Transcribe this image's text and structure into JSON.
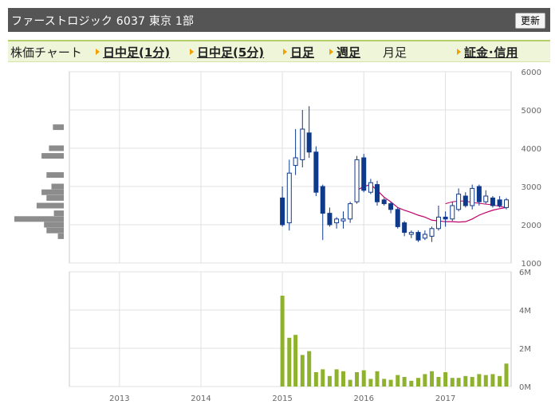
{
  "header": {
    "title": "ファーストロジック 6037 東京 1部",
    "refresh_label": "更新"
  },
  "tabs": [
    {
      "label": "株価チャート",
      "link": false
    },
    {
      "label": "日中足(1分)",
      "link": true
    },
    {
      "label": "日中足(5分)",
      "link": true
    },
    {
      "label": "日足",
      "link": true
    },
    {
      "label": "週足",
      "link": true
    },
    {
      "label": "月足",
      "link": false
    },
    {
      "label": "証金･信用",
      "link": true
    }
  ],
  "colors": {
    "up_candle": "#ffffff",
    "down_candle": "#0f3a8c",
    "moving_average": "#c0006b",
    "volume": "#8fb22e",
    "volume_profile": "#8c8c8c"
  },
  "chart_data": [
    {
      "type": "candlestick",
      "x_ticks": [
        "2013",
        "2014",
        "2015",
        "2016",
        "2017"
      ],
      "x_range": [
        "2012-06",
        "2017-10"
      ],
      "ylim": [
        1000,
        6000
      ],
      "y_ticks": [
        "6000",
        "5000",
        "4000",
        "3000",
        "2000",
        "1000"
      ],
      "grid": true,
      "candles": [
        {
          "date": "2015-01",
          "open": 2700,
          "high": 3000,
          "low": 1950,
          "close": 2000
        },
        {
          "date": "2015-02",
          "open": 2050,
          "high": 3700,
          "low": 1850,
          "close": 3350
        },
        {
          "date": "2015-03",
          "open": 3550,
          "high": 4500,
          "low": 3300,
          "close": 3750
        },
        {
          "date": "2015-04",
          "open": 3700,
          "high": 5000,
          "low": 3500,
          "close": 4500
        },
        {
          "date": "2015-05",
          "open": 4400,
          "high": 5100,
          "low": 3750,
          "close": 3900
        },
        {
          "date": "2015-06",
          "open": 3900,
          "high": 4050,
          "low": 2750,
          "close": 2850
        },
        {
          "date": "2015-07",
          "open": 3000,
          "high": 3050,
          "low": 1600,
          "close": 2300
        },
        {
          "date": "2015-08",
          "open": 2300,
          "high": 2450,
          "low": 1950,
          "close": 2000
        },
        {
          "date": "2015-09",
          "open": 2050,
          "high": 2200,
          "low": 1900,
          "close": 2150
        },
        {
          "date": "2015-10",
          "open": 2100,
          "high": 2350,
          "low": 1900,
          "close": 2150
        },
        {
          "date": "2015-11",
          "open": 2150,
          "high": 2600,
          "low": 2050,
          "close": 2550
        },
        {
          "date": "2015-12",
          "open": 2600,
          "high": 3800,
          "low": 2550,
          "close": 3700
        },
        {
          "date": "2016-01",
          "open": 3750,
          "high": 3850,
          "low": 2850,
          "close": 2900
        },
        {
          "date": "2016-02",
          "open": 2850,
          "high": 3200,
          "low": 2800,
          "close": 3100
        },
        {
          "date": "2016-03",
          "open": 3050,
          "high": 3150,
          "low": 2500,
          "close": 2600
        },
        {
          "date": "2016-04",
          "open": 2650,
          "high": 2700,
          "low": 2500,
          "close": 2550
        },
        {
          "date": "2016-05",
          "open": 2550,
          "high": 2600,
          "low": 2300,
          "close": 2400
        },
        {
          "date": "2016-06",
          "open": 2400,
          "high": 2450,
          "low": 1900,
          "close": 1950
        },
        {
          "date": "2016-07",
          "open": 2050,
          "high": 2100,
          "low": 1700,
          "close": 1800
        },
        {
          "date": "2016-08",
          "open": 1750,
          "high": 1850,
          "low": 1650,
          "close": 1800
        },
        {
          "date": "2016-09",
          "open": 1800,
          "high": 1850,
          "low": 1550,
          "close": 1600
        },
        {
          "date": "2016-10",
          "open": 1650,
          "high": 1850,
          "low": 1600,
          "close": 1750
        },
        {
          "date": "2016-11",
          "open": 1700,
          "high": 1950,
          "low": 1550,
          "close": 1900
        },
        {
          "date": "2016-12",
          "open": 1900,
          "high": 2500,
          "low": 1850,
          "close": 2200
        },
        {
          "date": "2017-01",
          "open": 2200,
          "high": 2350,
          "low": 1950,
          "close": 2150
        },
        {
          "date": "2017-02",
          "open": 2150,
          "high": 2600,
          "low": 2100,
          "close": 2500
        },
        {
          "date": "2017-03",
          "open": 2400,
          "high": 2950,
          "low": 2350,
          "close": 2800
        },
        {
          "date": "2017-04",
          "open": 2750,
          "high": 2850,
          "low": 2450,
          "close": 2500
        },
        {
          "date": "2017-05",
          "open": 2500,
          "high": 3050,
          "low": 2400,
          "close": 2950
        },
        {
          "date": "2017-06",
          "open": 3000,
          "high": 3050,
          "low": 2500,
          "close": 2600
        },
        {
          "date": "2017-07",
          "open": 2600,
          "high": 2900,
          "low": 2550,
          "close": 2750
        },
        {
          "date": "2017-08",
          "open": 2700,
          "high": 2750,
          "low": 2450,
          "close": 2500
        },
        {
          "date": "2017-09",
          "open": 2650,
          "high": 2750,
          "low": 2450,
          "close": 2500
        },
        {
          "date": "2017-10",
          "open": 2450,
          "high": 2700,
          "low": 2400,
          "close": 2650
        }
      ],
      "moving_average": [
        {
          "date": "2015-12",
          "value": 2900
        },
        {
          "date": "2016-01",
          "value": 3000
        },
        {
          "date": "2016-02",
          "value": 3050
        },
        {
          "date": "2016-03",
          "value": 2900
        },
        {
          "date": "2016-04",
          "value": 2720
        },
        {
          "date": "2016-05",
          "value": 2600
        },
        {
          "date": "2016-06",
          "value": 2450
        },
        {
          "date": "2016-07",
          "value": 2380
        },
        {
          "date": "2016-08",
          "value": 2320
        },
        {
          "date": "2016-09",
          "value": 2250
        },
        {
          "date": "2016-10",
          "value": 2200
        },
        {
          "date": "2016-11",
          "value": 2120
        },
        {
          "date": "2016-12",
          "value": 2100
        },
        {
          "date": "2017-01",
          "value": 2080
        },
        {
          "date": "2017-02",
          "value": 2080
        },
        {
          "date": "2017-03",
          "value": 2070
        },
        {
          "date": "2017-04",
          "value": 2080
        },
        {
          "date": "2017-05",
          "value": 2150
        },
        {
          "date": "2017-06",
          "value": 2250
        },
        {
          "date": "2017-07",
          "value": 2320
        },
        {
          "date": "2017-08",
          "value": 2380
        },
        {
          "date": "2017-09",
          "value": 2420
        },
        {
          "date": "2017-10",
          "value": 2450
        }
      ],
      "moving_average_2": [
        {
          "date": "2017-01",
          "value": 2550
        },
        {
          "date": "2017-02",
          "value": 2600
        },
        {
          "date": "2017-03",
          "value": 2620
        },
        {
          "date": "2017-04",
          "value": 2620
        },
        {
          "date": "2017-05",
          "value": 2580
        },
        {
          "date": "2017-06",
          "value": 2560
        },
        {
          "date": "2017-07",
          "value": 2540
        },
        {
          "date": "2017-08",
          "value": 2520
        },
        {
          "date": "2017-09",
          "value": 2480
        },
        {
          "date": "2017-10",
          "value": 2450
        }
      ],
      "volume_profile": [
        {
          "price": 1700,
          "amount": 0.12
        },
        {
          "price": 1850,
          "amount": 0.35
        },
        {
          "price": 2000,
          "amount": 0.4
        },
        {
          "price": 2150,
          "amount": 1.0
        },
        {
          "price": 2300,
          "amount": 0.2
        },
        {
          "price": 2500,
          "amount": 0.55
        },
        {
          "price": 2700,
          "amount": 0.35
        },
        {
          "price": 2850,
          "amount": 0.45
        },
        {
          "price": 3000,
          "amount": 0.25
        },
        {
          "price": 3300,
          "amount": 0.35
        },
        {
          "price": 3800,
          "amount": 0.45
        },
        {
          "price": 4000,
          "amount": 0.3
        },
        {
          "price": 4550,
          "amount": 0.22
        }
      ]
    },
    {
      "type": "bar",
      "series_name": "volume",
      "ylim": [
        0,
        6
      ],
      "y_ticks": [
        "6M",
        "4M",
        "2M",
        "0M"
      ],
      "x_ticks": [
        "2013",
        "2014",
        "2015",
        "2016",
        "2017"
      ],
      "grid": true,
      "dates": [
        "2015-01",
        "2015-02",
        "2015-03",
        "2015-04",
        "2015-05",
        "2015-06",
        "2015-07",
        "2015-08",
        "2015-09",
        "2015-10",
        "2015-11",
        "2015-12",
        "2016-01",
        "2016-02",
        "2016-03",
        "2016-04",
        "2016-05",
        "2016-06",
        "2016-07",
        "2016-08",
        "2016-09",
        "2016-10",
        "2016-11",
        "2016-12",
        "2017-01",
        "2017-02",
        "2017-03",
        "2017-04",
        "2017-05",
        "2017-06",
        "2017-07",
        "2017-08",
        "2017-09",
        "2017-10"
      ],
      "values": [
        4.75,
        2.55,
        2.7,
        1.65,
        1.85,
        0.75,
        0.9,
        0.55,
        0.9,
        0.8,
        0.35,
        0.75,
        0.85,
        0.4,
        0.8,
        0.4,
        0.35,
        0.6,
        0.5,
        0.3,
        0.45,
        0.65,
        0.8,
        0.5,
        0.75,
        0.45,
        0.45,
        0.55,
        0.5,
        0.65,
        0.6,
        0.65,
        0.55,
        1.2
      ]
    }
  ]
}
